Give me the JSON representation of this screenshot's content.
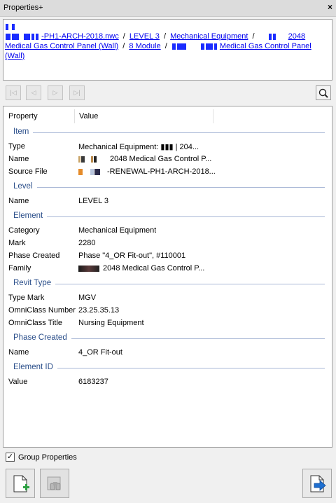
{
  "window": {
    "title": "Properties+",
    "close_glyph": "×"
  },
  "breadcrumb": {
    "crumbs": [
      "-PH1-ARCH-2018.nwc",
      "LEVEL 3",
      "Mechanical Equipment",
      "2048",
      "Medical Gas Control Panel (Wall)",
      "8 Module",
      "Medical Gas Control Panel (Wall)"
    ],
    "separator": "/"
  },
  "toolbar": {
    "first_glyph": "|◁",
    "prev_glyph": "◁",
    "next_glyph": "▷",
    "last_glyph": "▷|",
    "search_icon": "magnifier-icon"
  },
  "grid": {
    "headers": {
      "property": "Property",
      "value": "Value"
    },
    "sections": [
      {
        "title": "Item",
        "rows": [
          {
            "key": "Type",
            "value": "Mechanical Equipment: ▮▮▮ | 204..."
          },
          {
            "key": "Name",
            "value": "2048 Medical Gas Control P..."
          },
          {
            "key": "Source File",
            "value": "-RENEWAL-PH1-ARCH-2018..."
          }
        ]
      },
      {
        "title": "Level",
        "rows": [
          {
            "key": "Name",
            "value": "LEVEL 3"
          }
        ]
      },
      {
        "title": "Element",
        "rows": [
          {
            "key": "Category",
            "value": "Mechanical Equipment"
          },
          {
            "key": "Mark",
            "value": "2280"
          },
          {
            "key": "Phase Created",
            "value": "Phase \"4_OR Fit-out\", #110001"
          },
          {
            "key": "Family",
            "value": "2048 Medical Gas Control P..."
          }
        ]
      },
      {
        "title": "Revit Type",
        "rows": [
          {
            "key": "Type Mark",
            "value": "MGV"
          },
          {
            "key": "OmniClass Number",
            "value": "23.25.35.13"
          },
          {
            "key": "OmniClass Title",
            "value": "Nursing Equipment"
          }
        ]
      },
      {
        "title": "Phase Created",
        "rows": [
          {
            "key": "Name",
            "value": "4_OR Fit-out"
          }
        ]
      },
      {
        "title": "Element ID",
        "rows": [
          {
            "key": "Value",
            "value": "6183237"
          }
        ]
      }
    ]
  },
  "footer": {
    "group_properties_label": "Group Properties",
    "group_properties_checked": true,
    "check_glyph": "✓"
  },
  "colors": {
    "link": "#0000ee",
    "section_title": "#2a4e8a",
    "accent_green": "#2ea043",
    "accent_blue": "#1e6fd0"
  }
}
